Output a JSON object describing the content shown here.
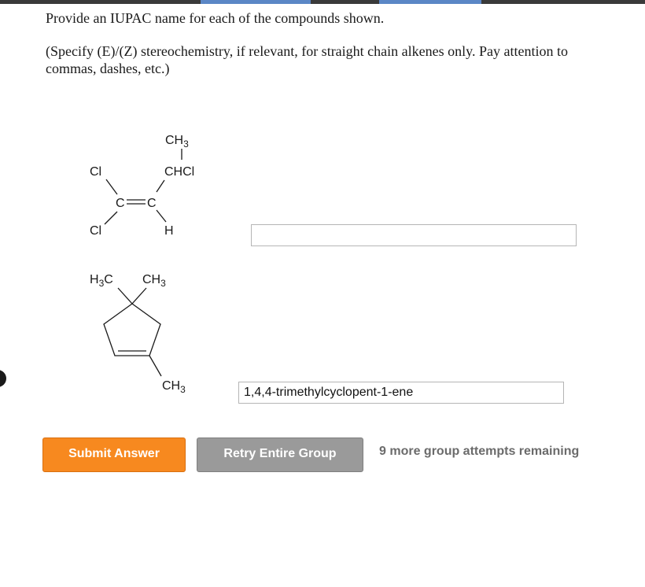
{
  "instructions": {
    "line1": "Provide an IUPAC name for each of the compounds shown.",
    "line2": "(Specify (E)/(Z) stereochemistry, if relevant, for straight chain alkenes only. Pay attention to commas, dashes, etc.)"
  },
  "compound1": {
    "ch3": "CH",
    "ch3_sub": "3",
    "chcl": "CHCl",
    "cl_top": "Cl",
    "cl_bottom": "Cl",
    "c_left": "C",
    "c_right": "C",
    "h": "H"
  },
  "compound2": {
    "h3c_h": "H",
    "h3c_sub": "3",
    "h3c_c": "C",
    "ch3_top": "CH",
    "ch3_top_sub": "3",
    "ch3_bottom": "CH",
    "ch3_bottom_sub": "3"
  },
  "answers": {
    "answer1_value": "",
    "answer2_value": "1,4,4-trimethylcyclopent-1-ene"
  },
  "buttons": {
    "submit": "Submit Answer",
    "retry": "Retry Entire Group"
  },
  "status": {
    "attempts": "9 more group attempts remaining"
  },
  "colors": {
    "submit": "#f7891f",
    "retry": "#9a9a9a",
    "attempts_text": "#6b6b6b"
  }
}
